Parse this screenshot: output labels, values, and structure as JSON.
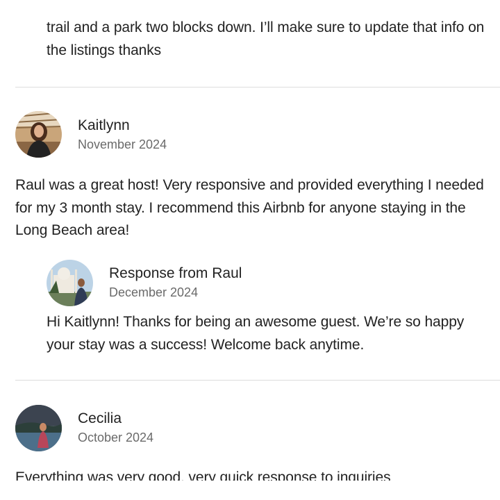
{
  "prev_review": {
    "text": "trail and a park two blocks down. I’ll make sure to update that info on the listings thanks"
  },
  "reviews": [
    {
      "name": "Kaitlynn",
      "date": "November 2024",
      "text": "Raul was a great host! Very responsive and provided everything I needed for my 3 month stay. I recommend this Airbnb for anyone staying in the Long Beach area!",
      "response": {
        "title": "Response from Raul",
        "date": "December 2024",
        "text": "Hi Kaitlynn! Thanks for being an awesome guest. We’re so happy your stay was a success! Welcome back anytime."
      }
    },
    {
      "name": "Cecilia",
      "date": "October 2024",
      "text": "Everything was very good, very quick response to inquiries"
    }
  ]
}
